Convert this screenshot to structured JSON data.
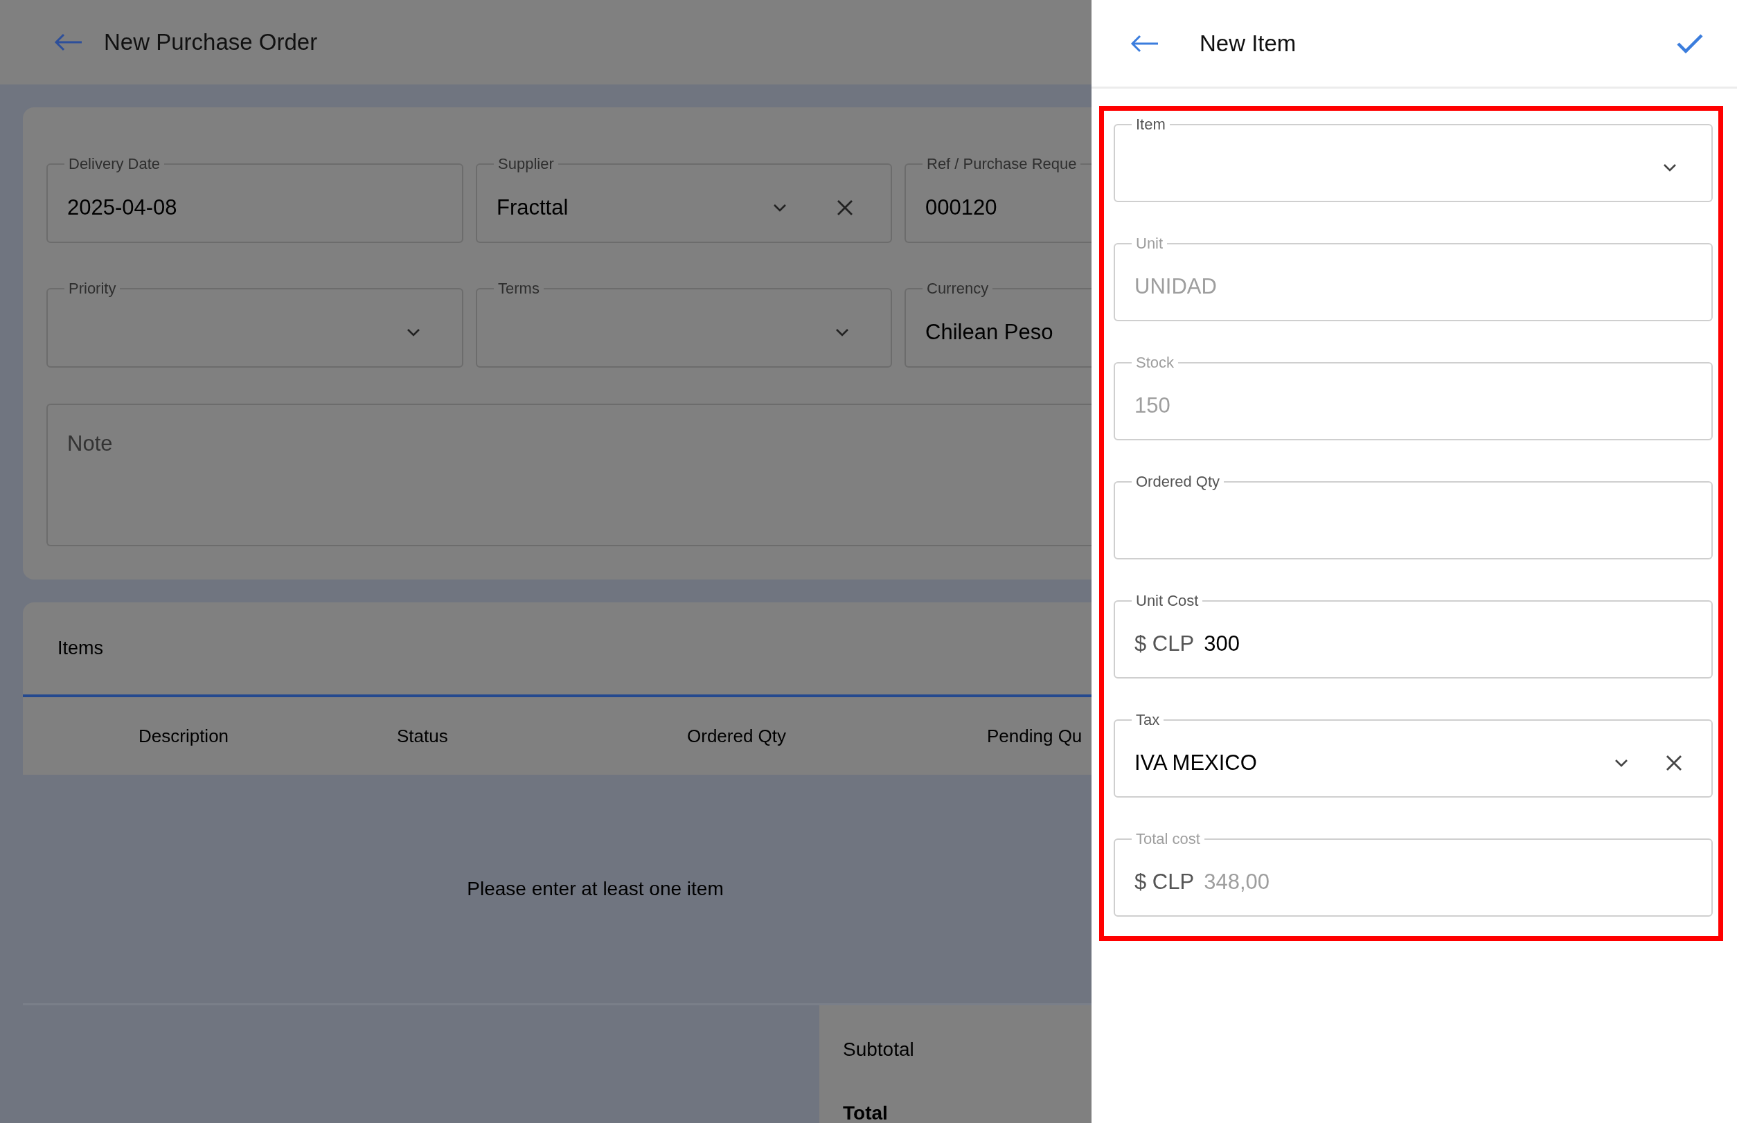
{
  "main": {
    "title": "New Purchase Order",
    "fields": [
      {
        "kind": "text",
        "label": "Delivery Date",
        "value": "2025-04-08"
      },
      {
        "kind": "select",
        "label": "Supplier",
        "value": "Fracttal",
        "clearable": true
      },
      {
        "kind": "text",
        "label": "Ref / Purchase Reque",
        "value": "000120"
      },
      {
        "kind": "select",
        "label": "Priority",
        "clearable": false
      },
      {
        "kind": "select",
        "label": "Terms",
        "clearable": false
      },
      {
        "kind": "text",
        "label": "Currency",
        "value": "Chilean Peso"
      }
    ],
    "note": {
      "placeholder": "Note"
    },
    "items": {
      "title": "Items",
      "columns": [
        "Description",
        "Status",
        "Ordered Qty",
        "Pending Qu"
      ],
      "empty_message": "Please enter at least one item",
      "totals": [
        {
          "label": "Subtotal",
          "bold": false
        },
        {
          "label": "Total",
          "bold": true
        }
      ]
    }
  },
  "panel": {
    "title": "New Item",
    "highlighted": true,
    "fields": [
      {
        "kind": "select",
        "label": "Item",
        "clearable": false,
        "disabled": false
      },
      {
        "kind": "text",
        "label": "Unit",
        "value": "UNIDAD",
        "disabled": true
      },
      {
        "kind": "text",
        "label": "Stock",
        "value": "150",
        "disabled": true
      },
      {
        "kind": "text",
        "label": "Ordered Qty",
        "disabled": false
      },
      {
        "kind": "currency",
        "label": "Unit Cost",
        "prefix": "$ CLP",
        "value": "300",
        "disabled": false
      },
      {
        "kind": "select",
        "label": "Tax",
        "value": "IVA MEXICO",
        "clearable": true,
        "disabled": false
      },
      {
        "kind": "currency",
        "label": "Total cost",
        "prefix": "$ CLP",
        "value": "348,00",
        "disabled": true
      }
    ]
  }
}
